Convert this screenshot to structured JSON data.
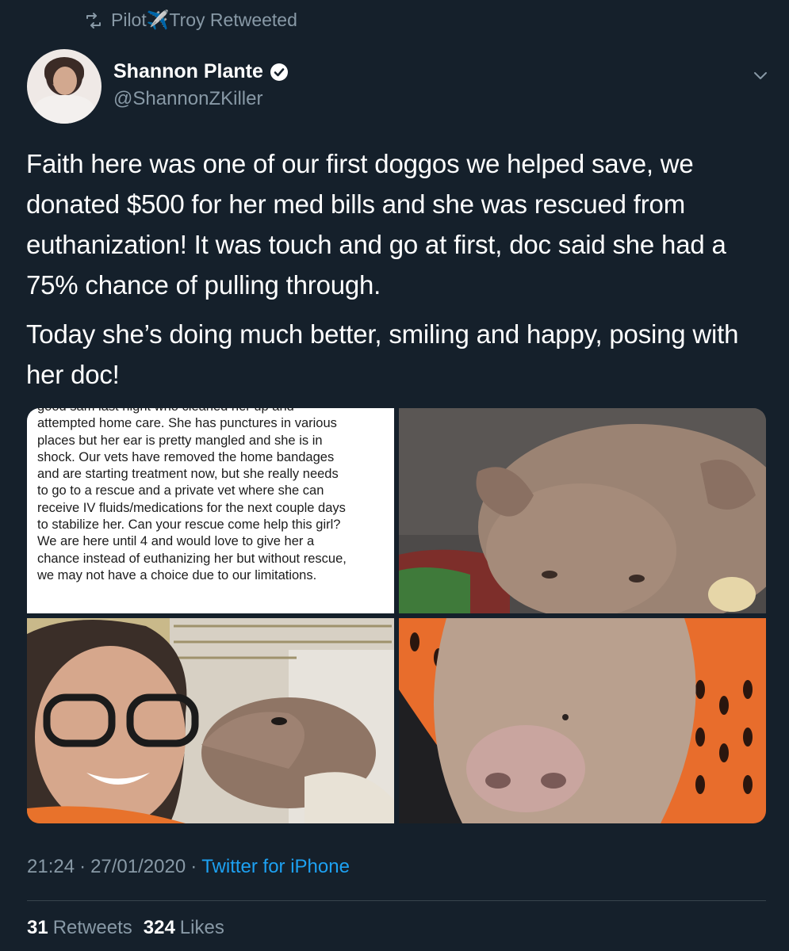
{
  "retweet_header": {
    "text": "Pilot✈️Troy Retweeted"
  },
  "author": {
    "display_name": "Shannon Plante",
    "handle": "@ShannonZKiller"
  },
  "tweet": {
    "paragraphs": [
      "Faith here was one of our first doggos we helped save, we donated $500 for her med bills and she was rescued from euthanization! It was touch and go at first, doc said she had a 75% chance of pulling through.",
      "Today she’s doing much better, smiling and happy, posing with her doc!"
    ]
  },
  "media": {
    "screenshot_lines": [
      "good sam last night who cleaned her up and",
      "attempted home care. She has punctures in various",
      "places but her ear is pretty mangled and she is in",
      "shock. Our vets have removed the home bandages",
      "and are starting treatment now, but she really needs",
      "to go to a rescue and a private vet where she can",
      "receive IV fluids/medications for the next couple days",
      "to stabilize her. Can your rescue come help this girl?",
      "We are here until 4 and would love to give her a",
      "chance instead of euthanizing her but without rescue,",
      "we may not have a choice due to our limitations."
    ]
  },
  "meta": {
    "time": "21:24",
    "date": "27/01/2020",
    "separator": "·",
    "source": "Twitter for iPhone"
  },
  "stats": {
    "retweets_count": "31",
    "retweets_label": "Retweets",
    "likes_count": "324",
    "likes_label": "Likes"
  },
  "colors": {
    "background": "#15202b",
    "secondary_text": "#8899a6",
    "accent": "#1da1f2",
    "divider": "#38444d"
  }
}
